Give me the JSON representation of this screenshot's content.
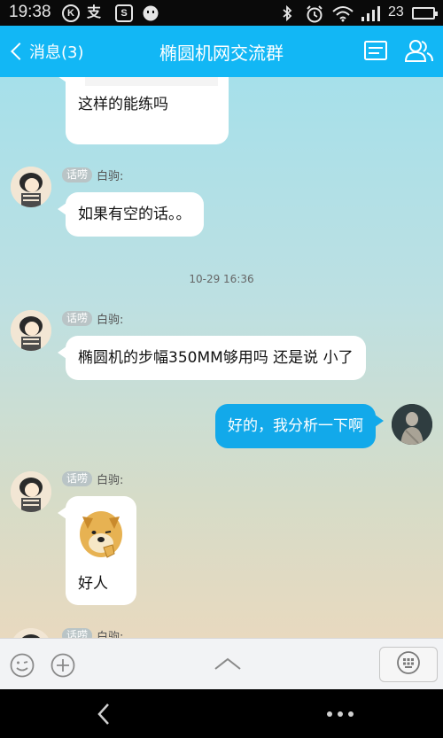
{
  "status_bar": {
    "time": "19:38",
    "notif_icons": [
      "k-circle-icon",
      "zhi-icon",
      "s-box-icon",
      "chat-face-icon"
    ],
    "zhi_label": "支",
    "k_label": "K",
    "s_label": "S",
    "battery_level": "23",
    "system_icons": [
      "bluetooth-icon",
      "alarm-icon",
      "wifi-icon",
      "signal-icon",
      "battery-icon"
    ]
  },
  "header": {
    "back_label": "消息(3)",
    "title": "椭圆机网交流群",
    "icons": [
      "group-info-icon",
      "group-members-icon"
    ],
    "accent_color": "#12b7f5"
  },
  "messages": [
    {
      "type": "text",
      "sender_side": "left",
      "text": "这样的能练吗",
      "has_image_above": true
    },
    {
      "type": "text",
      "sender_side": "left",
      "badge": "话唠",
      "sender": "白驹:",
      "text": "如果有空的话。。"
    },
    {
      "type": "timestamp",
      "text": "10-29 16:36"
    },
    {
      "type": "text",
      "sender_side": "left",
      "badge": "话唠",
      "sender": "白驹:",
      "text": "椭圆机的步幅350MM够用吗 还是说 小了"
    },
    {
      "type": "text",
      "sender_side": "right",
      "text": "好的，我分析一下啊",
      "bubble_color": "#12a9ea"
    },
    {
      "type": "image_text",
      "sender_side": "left",
      "badge": "话唠",
      "sender": "白驹:",
      "sticker": "doge-sticker",
      "text": "好人"
    },
    {
      "type": "partial",
      "sender_side": "left",
      "badge": "话唠",
      "sender": "白驹:"
    }
  ],
  "input_bar": {
    "icons": [
      "emoji-icon",
      "plus-icon",
      "chevron-up-icon",
      "keyboard-icon"
    ]
  },
  "nav_bar": {
    "icons": [
      "back-arrow-icon",
      "more-dots-icon"
    ]
  }
}
